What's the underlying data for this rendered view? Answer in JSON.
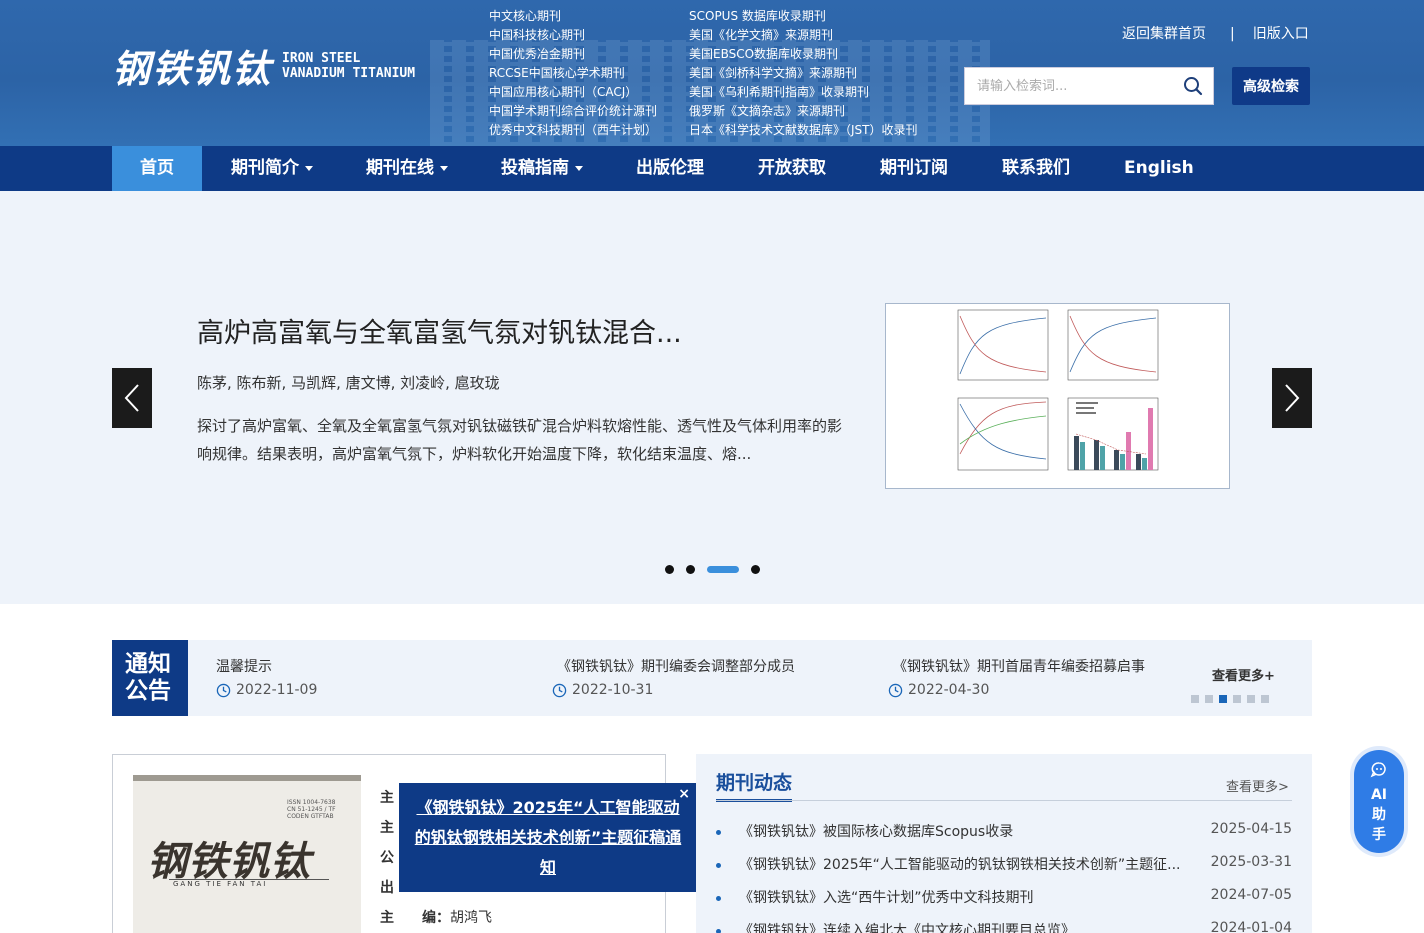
{
  "header": {
    "logo_cn": "钢铁钒钛",
    "logo_en_line1": "IRON STEEL",
    "logo_en_line2": "VANADIUM TITANIUM",
    "indexing_col1": [
      "中文核心期刊",
      "中国科技核心期刊",
      "中国优秀冶金期刊",
      "RCCSE中国核心学术期刊",
      "中国应用核心期刊（CACJ）",
      "中国学术期刊综合评价统计源刊",
      "优秀中文科技期刊（西牛计划）"
    ],
    "indexing_col2": [
      "SCOPUS 数据库收录期刊",
      "美国《化学文摘》来源期刊",
      "美国EBSCO数据库收录期刊",
      "美国《剑桥科学文摘》来源期刊",
      "美国《乌利希期刊指南》收录期刊",
      "俄罗斯《文摘杂志》来源期刊",
      "日本《科学技术文献数据库》（JST）收录刊"
    ],
    "link_home": "返回集群首页",
    "link_sep": "|",
    "link_old": "旧版入口",
    "search_placeholder": "请输入检索词...",
    "advanced_search": "高级检索"
  },
  "nav": {
    "items": [
      {
        "label": "首页",
        "caret": false
      },
      {
        "label": "期刊简介",
        "caret": true
      },
      {
        "label": "期刊在线",
        "caret": true
      },
      {
        "label": "投稿指南",
        "caret": true
      },
      {
        "label": "出版伦理",
        "caret": false
      },
      {
        "label": "开放获取",
        "caret": false
      },
      {
        "label": "期刊订阅",
        "caret": false
      },
      {
        "label": "联系我们",
        "caret": false
      },
      {
        "label": "English",
        "caret": false
      }
    ],
    "active_index": 0
  },
  "banner": {
    "title": "高炉高富氧与全氧富氢气氛对钒钛混合...",
    "authors": "陈茅, 陈布新, 马凯辉, 唐文博, 刘凌岭, 扈玫珑",
    "abstract": "探讨了高炉富氧、全氧及全氧富氢气氛对钒钛磁铁矿混合炉料软熔性能、透气性及气体利用率的影响规律。结果表明，高炉富氧气氛下，炉料软化开始温度下降，软化结束温度、熔...",
    "dots_count": 4,
    "active_dot": 2
  },
  "notice": {
    "tag_line1": "通知",
    "tag_line2": "公告",
    "items": [
      {
        "title": "温馨提示",
        "date": "2022-11-09"
      },
      {
        "title": "《钢铁钒钛》期刊编委会调整部分成员",
        "date": "2022-10-31"
      },
      {
        "title": "《钢铁钒钛》期刊首届青年编委招募启事",
        "date": "2022-04-30"
      }
    ],
    "more": "查看更多+",
    "page_count": 6,
    "active_page": 2
  },
  "journal": {
    "cover_title": "钢铁钒钛",
    "cover_issn": [
      "ISSN 1004-7638",
      "CN 51-1245 / TF",
      "CODEN GTFTAB"
    ],
    "cover_pinyin": "GANG TIE FAN TAI",
    "info": [
      {
        "label": "主",
        "value": ""
      },
      {
        "label": "主",
        "value": ""
      },
      {
        "label": "公",
        "value": ""
      },
      {
        "label": "出",
        "value": ""
      },
      {
        "label": "主　　编：",
        "value": "胡鸿飞"
      }
    ]
  },
  "popup": {
    "text": "《钢铁钒钛》2025年“人工智能驱动的钒钛钢铁相关技术创新”主题征稿通知",
    "close": "×"
  },
  "news": {
    "heading": "期刊动态",
    "more": "查看更多>",
    "items": [
      {
        "title": "《钢铁钒钛》被国际核心数据库Scopus收录",
        "date": "2025-04-15"
      },
      {
        "title": "《钢铁钒钛》2025年“人工智能驱动的钒钛钢铁相关技术创新”主题征...",
        "date": "2025-03-31"
      },
      {
        "title": "《钢铁钒钛》入选“西牛计划”优秀中文科技期刊",
        "date": "2024-07-05"
      },
      {
        "title": "《钢铁钒钛》连续入编北大《中文核心期刊要目总览》",
        "date": "2024-01-04"
      }
    ]
  },
  "ai_assistant": {
    "line1": "AI",
    "line2": "助",
    "line3": "手"
  },
  "icons": {
    "search": "search-icon",
    "clock": "clock-icon",
    "prev": "chevron-left-icon",
    "next": "chevron-right-icon",
    "ai": "ai-assistant-icon"
  }
}
